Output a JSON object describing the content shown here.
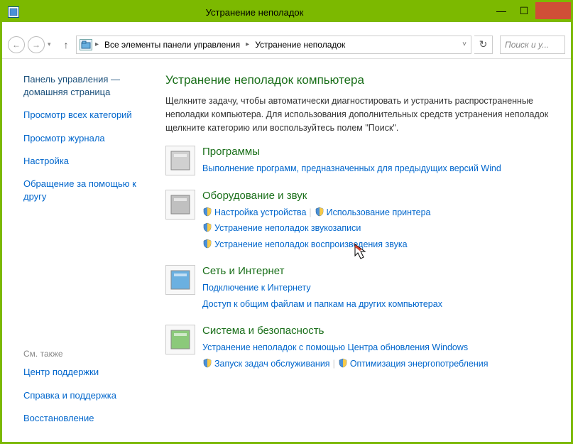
{
  "window": {
    "title": "Устранение неполадок"
  },
  "addr": {
    "seg1": "Все элементы панели управления",
    "seg2": "Устранение неполадок"
  },
  "search": {
    "placeholder": "Поиск и у..."
  },
  "sidebar": {
    "home": "Панель управления —\nдомашняя страница",
    "links": [
      "Просмотр всех категорий",
      "Просмотр журнала",
      "Настройка",
      "Обращение за помощью к другу"
    ],
    "see_also": "См. также",
    "footer": [
      "Центр поддержки",
      "Справка и поддержка",
      "Восстановление"
    ]
  },
  "main": {
    "title": "Устранение неполадок компьютера",
    "desc": "Щелкните задачу, чтобы автоматически диагностировать и устранить распространенные неполадки компьютера. Для использования дополнительных средств устранения неполадок щелкните категорию или воспользуйтесь полем \"Поиск\"."
  },
  "sections": [
    {
      "title": "Программы",
      "links": [
        {
          "text": "Выполнение программ, предназначенных для предыдущих версий Wind",
          "shield": false
        }
      ]
    },
    {
      "title": "Оборудование и звук",
      "links": [
        {
          "text": "Настройка устройства",
          "shield": true
        },
        {
          "text": "Использование принтера",
          "shield": true
        },
        {
          "text": "Устранение неполадок звукозаписи",
          "shield": true,
          "break_before": true
        },
        {
          "text": "Устранение неполадок воспроизведения звука",
          "shield": true,
          "break_before": true
        }
      ]
    },
    {
      "title": "Сеть и Интернет",
      "links": [
        {
          "text": "Подключение к Интернету",
          "shield": false
        },
        {
          "text": "Доступ к общим файлам и папкам на других компьютерах",
          "shield": false,
          "break_before": true
        }
      ]
    },
    {
      "title": "Система и безопасность",
      "links": [
        {
          "text": "Устранение неполадок с помощью Центра обновления Windows",
          "shield": false
        },
        {
          "text": "Запуск задач обслуживания",
          "shield": true,
          "break_before": true
        },
        {
          "text": "Оптимизация энергопотребления",
          "shield": true
        }
      ]
    }
  ]
}
